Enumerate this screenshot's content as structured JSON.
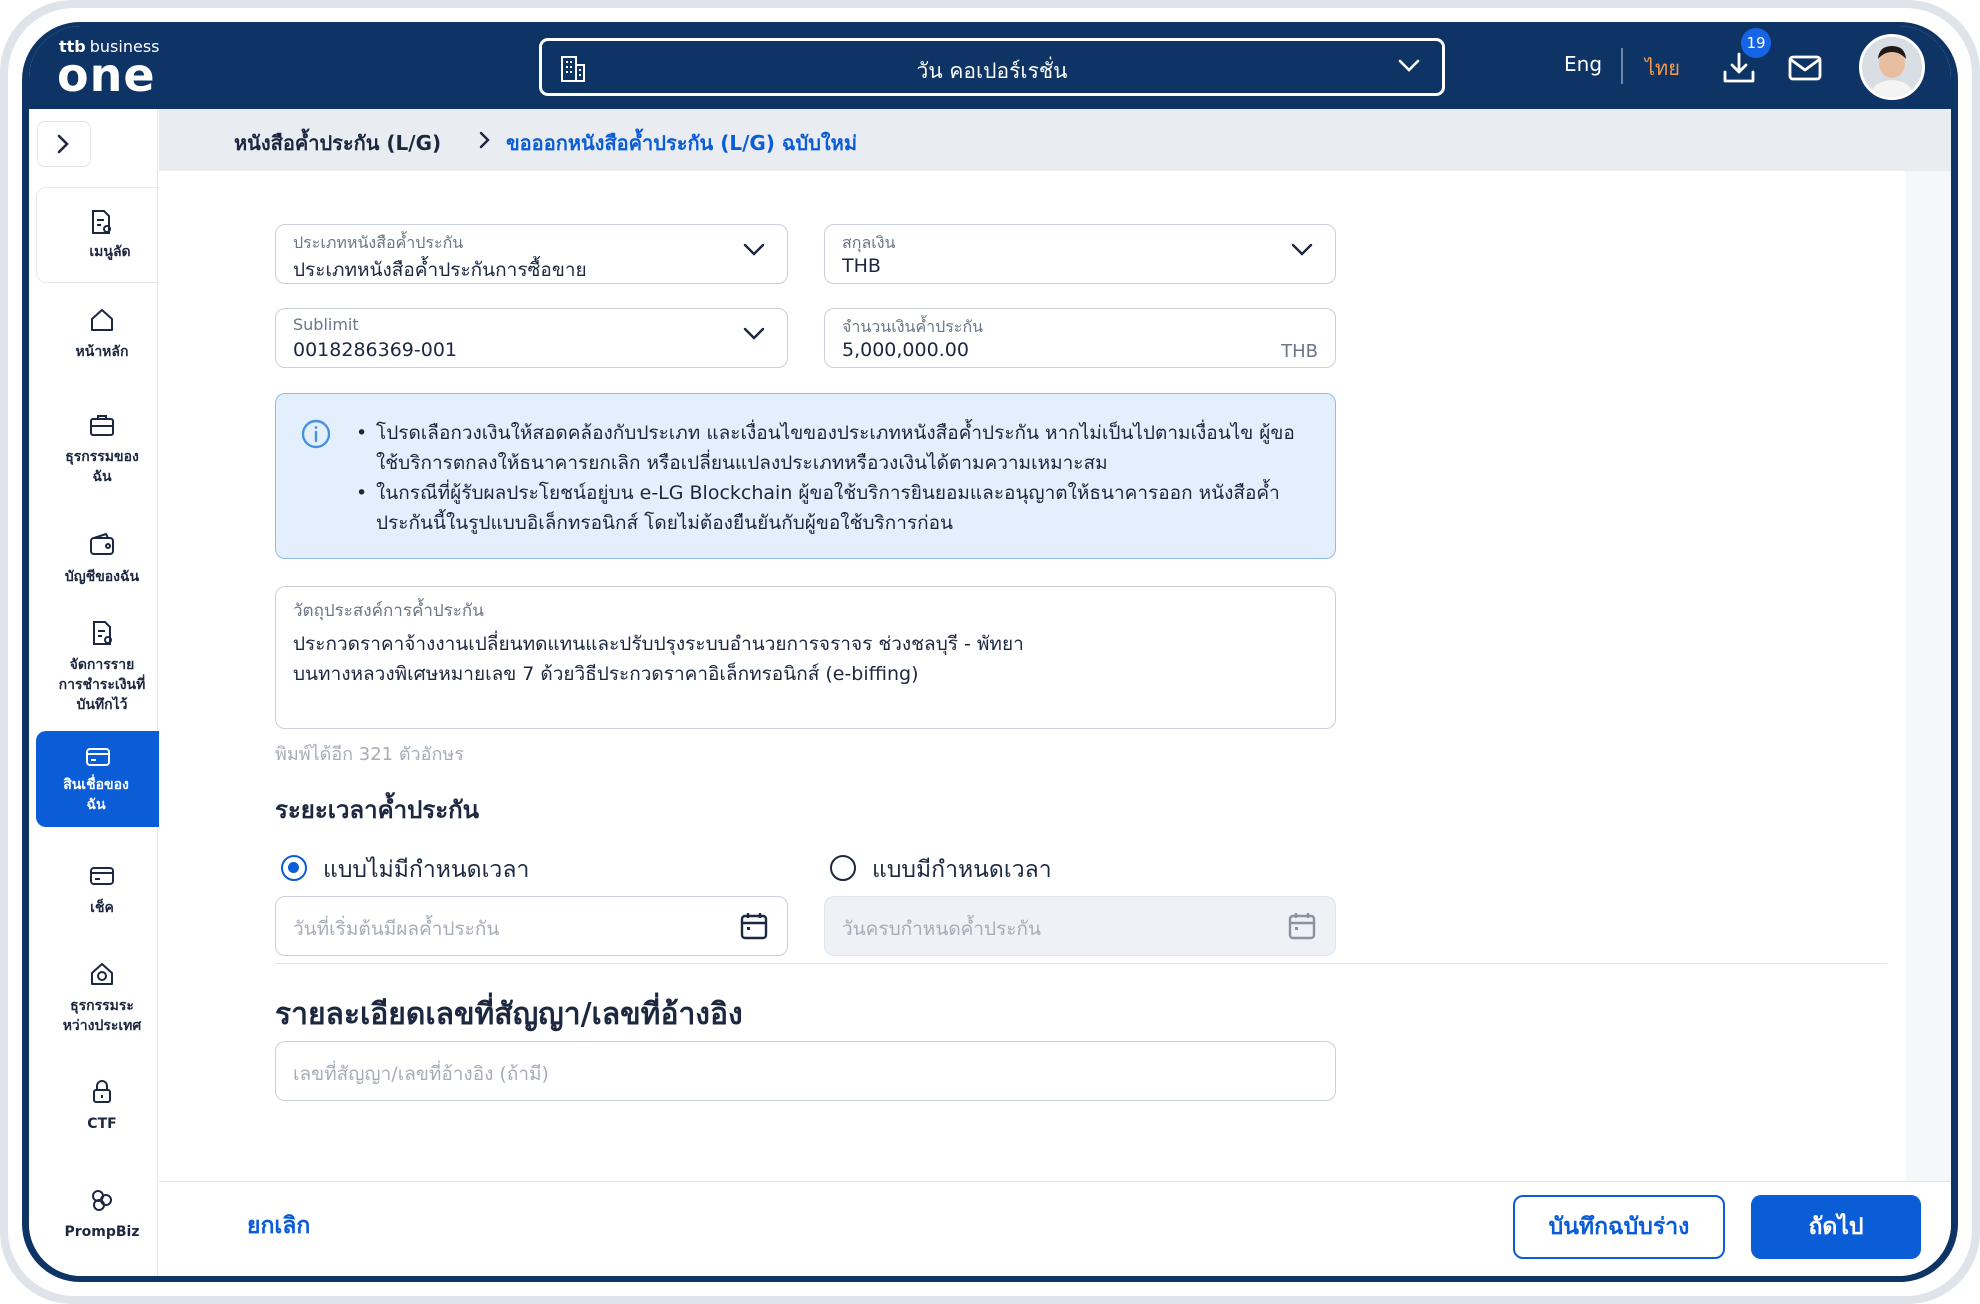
{
  "header": {
    "logo_prefix": "ttb",
    "logo_top": "business",
    "logo_main": "one",
    "company": "วัน คอเปอร์เรชั่น",
    "lang_en": "Eng",
    "lang_th": "ไทย",
    "download_badge": "19"
  },
  "sidebar": {
    "items": [
      {
        "label": "เมนูลัด"
      },
      {
        "label": "หน้าหลัก"
      },
      {
        "label": "ธุรกรรมของ\nฉัน"
      },
      {
        "label": "บัญชีของฉัน"
      },
      {
        "label": "จัดการราย\nการชำระเงินที่\nบันทึกไว้"
      },
      {
        "label": "สินเชื่อของ\nฉัน"
      },
      {
        "label": "เช็ค"
      },
      {
        "label": "ธุรกรรมระ\nหว่างประเทศ"
      },
      {
        "label": "CTF"
      },
      {
        "label": "PrompBiz"
      }
    ]
  },
  "breadcrumb": {
    "parent": "หนังสือค้ำประกัน (L/G)",
    "current": "ขอออกหนังสือค้ำประกัน (L/G) ฉบับใหม่"
  },
  "form": {
    "lg_type": {
      "label": "ประเภทหนังสือค้ำประกัน",
      "value": "ประเภทหนังสือค้ำประกันการซื้อขาย"
    },
    "currency": {
      "label": "สกุลเงิน",
      "value": "THB"
    },
    "sublimit": {
      "label": "Sublimit",
      "value": "0018286369-001"
    },
    "amount": {
      "label": "จำนวนเงินค้ำประกัน",
      "value": "5,000,000.00",
      "suffix": "THB"
    },
    "info": [
      "โปรดเลือกวงเงินให้สอดคล้องกับประเภท และเงื่อนไขของประเภทหนังสือค้ำประกัน หากไม่เป็นไปตามเงื่อนไข ผู้ขอใช้บริการตกลงให้ธนาคารยกเลิก หรือเปลี่ยนแปลงประเภทหรือวงเงินได้ตามความเหมาะสม",
      "ในกรณีที่ผู้รับผลประโยชน์อยู่บน e-LG Blockchain ผู้ขอใช้บริการยินยอมและอนุญาตให้ธนาคารออก หนังสือค้ำประกันนี้ในรูปแบบอิเล็กทรอนิกส์ โดยไม่ต้องยืนยันกับผู้ขอใช้บริการก่อน"
    ],
    "purpose": {
      "label": "วัตถุประสงค์การค้ำประกัน",
      "value": "ประกวดราคาจ้างงานเปลี่ยนทดแทนและปรับปรุงระบบอำนวยการจราจร ช่วงชลบุรี - พัทยา\nบนทางหลวงพิเศษหมายเลข 7 ด้วยวิธีประกวดราคาอิเล็กทรอนิกส์ (e-biffing)",
      "counter": "พิมพ์ได้อีก 321 ตัวอักษร"
    },
    "period": {
      "title": "ระยะเวลาค้ำประกัน",
      "option_open": "แบบไม่มีกำหนดเวลา",
      "option_fixed": "แบบมีกำหนดเวลา",
      "selected": "open",
      "start_placeholder": "วันที่เริ่มต้นมีผลค้ำประกัน",
      "end_placeholder": "วันครบกำหนดค้ำประกัน"
    },
    "contract": {
      "title": "รายละเอียดเลขที่สัญญา/เลขที่อ้างอิง",
      "placeholder": "เลขที่สัญญา/เลขที่อ้างอิง (ถ้ามี)"
    }
  },
  "footer": {
    "cancel": "ยกเลิก",
    "save_draft": "บันทึกฉบับร่าง",
    "next": "ถัดไป"
  },
  "colors": {
    "navy": "#0e3466",
    "primary": "#0b5cd7",
    "accent_orange": "#f2994a",
    "info_bg": "#e3effc"
  }
}
